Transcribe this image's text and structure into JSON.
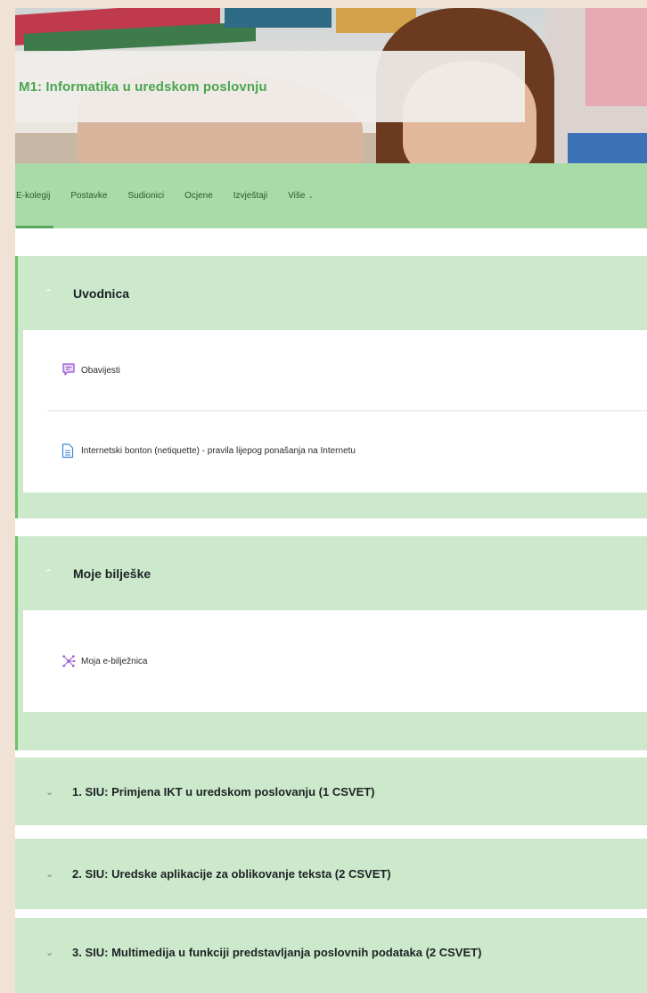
{
  "course": {
    "title": "M1: Informatika u uredskom poslovnju"
  },
  "nav": {
    "items": [
      {
        "label": "E-kolegij",
        "active": true
      },
      {
        "label": "Postavke"
      },
      {
        "label": "Sudionici"
      },
      {
        "label": "Ocjene"
      },
      {
        "label": "Izvještaji"
      },
      {
        "label": "Više",
        "icon": "chevron-down-icon"
      }
    ]
  },
  "sections": [
    {
      "title": "Uvodnica",
      "expanded": true,
      "activities": [
        {
          "label": "Obavijesti",
          "icon": "forum-icon"
        },
        {
          "label": "Internetski bonton (netiquette) - pravila lijepog ponašanja na Internetu",
          "icon": "page-icon"
        }
      ]
    },
    {
      "title": "Moje bilješke",
      "expanded": true,
      "activities": [
        {
          "label": "Moja e-bilježnica",
          "icon": "mindmap-icon"
        }
      ]
    },
    {
      "title": "1. SIU: Primjena IKT u uredskom poslovanju (1 CSVET)",
      "expanded": false
    },
    {
      "title": "2. SIU: Uredske aplikacije za oblikovanje teksta (2 CSVET)",
      "expanded": false
    },
    {
      "title": "3. SIU: Multimedija u funkciji predstavljanja poslovnih podataka (2 CSVET)",
      "expanded": false
    }
  ],
  "colors": {
    "accent": "#4aa64e",
    "nav_bg": "#a9dba8",
    "section_bg": "#cde9cb",
    "page_bg": "#f1e2d6"
  }
}
